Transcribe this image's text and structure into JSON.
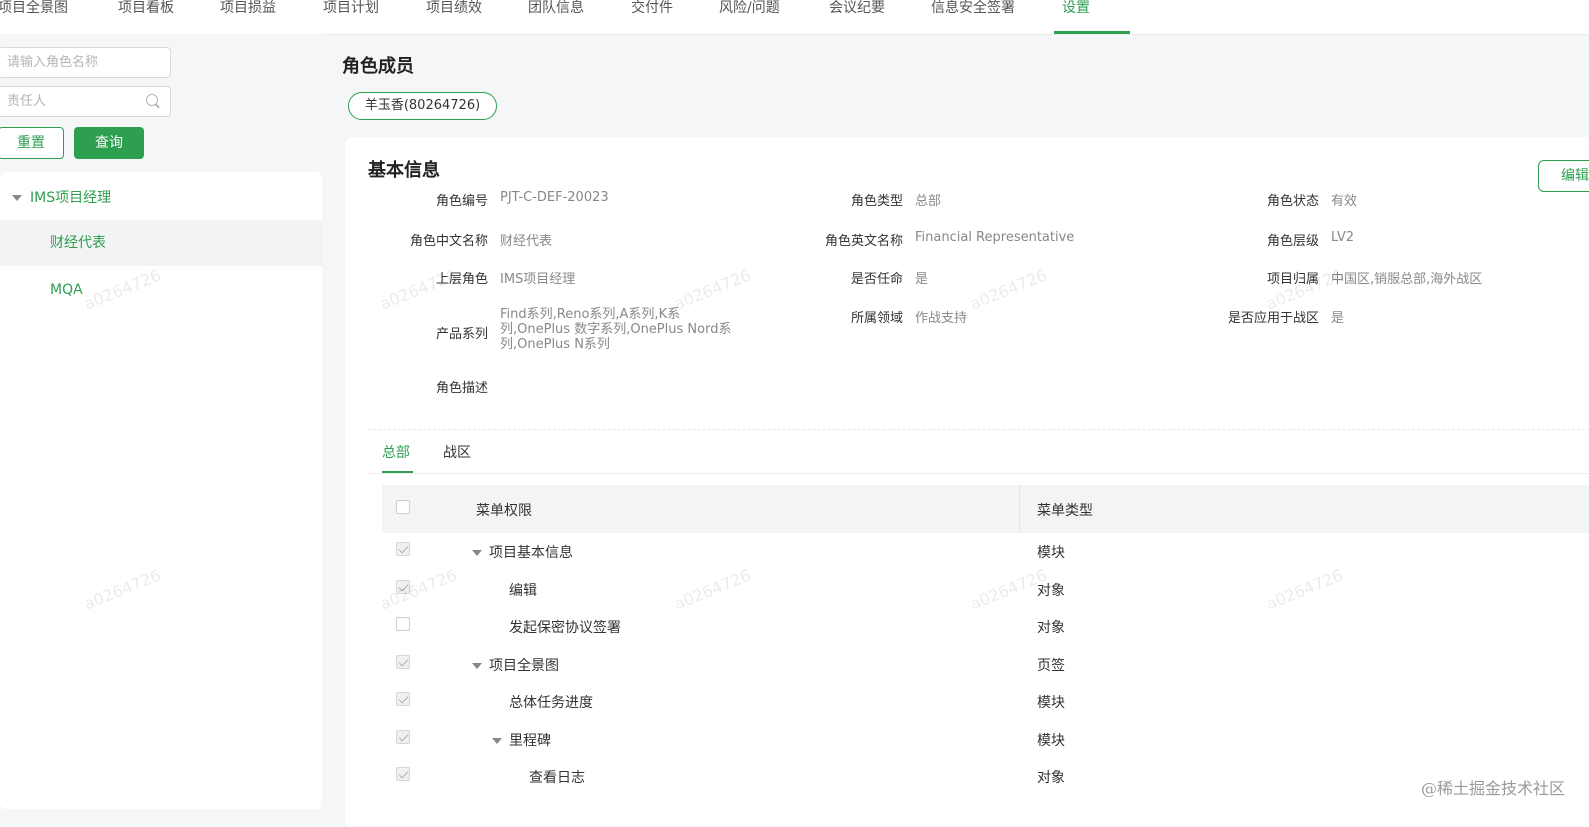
{
  "topnav": {
    "tabs": [
      "项目全景图",
      "项目看板",
      "项目损益",
      "项目计划",
      "项目绩效",
      "团队信息",
      "交付件",
      "风险/问题",
      "会议纪要",
      "信息安全签署",
      "设置"
    ],
    "active": "设置"
  },
  "filters": {
    "role_placeholder": "请输入角色名称",
    "owner_placeholder": "责任人",
    "reset_label": "重置",
    "query_label": "查询"
  },
  "tree": {
    "parent": "IMS项目经理",
    "children": [
      "财经代表",
      "MQA"
    ],
    "selected": "财经代表"
  },
  "members": {
    "title": "角色成员",
    "chip": "羊玉香(80264726)"
  },
  "basic_info": {
    "title": "基本信息",
    "edit_label": "编辑",
    "fields": {
      "role_code": {
        "label": "角色编号",
        "value": "PJT-C-DEF-20023"
      },
      "role_type": {
        "label": "角色类型",
        "value": "总部"
      },
      "role_status": {
        "label": "角色状态",
        "value": "有效"
      },
      "cn_name": {
        "label": "角色中文名称",
        "value": "财经代表"
      },
      "en_name": {
        "label": "角色英文名称",
        "value": "Financial Representative"
      },
      "role_level": {
        "label": "角色层级",
        "value": "LV2"
      },
      "parent_role": {
        "label": "上层角色",
        "value": "IMS项目经理"
      },
      "appointed": {
        "label": "是否任命",
        "value": "是"
      },
      "project_owner": {
        "label": "项目归属",
        "value": "中国区,销服总部,海外战区"
      },
      "product_series": {
        "label": "产品系列",
        "value": "Find系列,Reno系列,A系列,K系列,OnePlus 数字系列,OnePlus Nord系列,OnePlus N系列"
      },
      "domain": {
        "label": "所属领域",
        "value": "作战支持"
      },
      "for_warzone": {
        "label": "是否应用于战区",
        "value": "是"
      },
      "description": {
        "label": "角色描述",
        "value": ""
      }
    }
  },
  "sub_tabs": [
    "总部",
    "战区"
  ],
  "active_sub_tab": "总部",
  "permissions": {
    "headers": [
      "菜单权限",
      "菜单类型"
    ],
    "rows": [
      {
        "name": "项目基本信息",
        "type": "模块",
        "level": 0,
        "expanded": true,
        "checked": true
      },
      {
        "name": "编辑",
        "type": "对象",
        "level": 1,
        "checked": true
      },
      {
        "name": "发起保密协议签署",
        "type": "对象",
        "level": 1,
        "checked": false
      },
      {
        "name": "项目全景图",
        "type": "页签",
        "level": 0,
        "expanded": true,
        "checked": true
      },
      {
        "name": "总体任务进度",
        "type": "模块",
        "level": 1,
        "checked": true
      },
      {
        "name": "里程碑",
        "type": "模块",
        "level": 1,
        "expanded": true,
        "checked": true
      },
      {
        "name": "查看日志",
        "type": "对象",
        "level": 2,
        "checked": true
      }
    ]
  },
  "watermark": "a0264726",
  "footer_watermark": "@稀土掘金技术社区"
}
